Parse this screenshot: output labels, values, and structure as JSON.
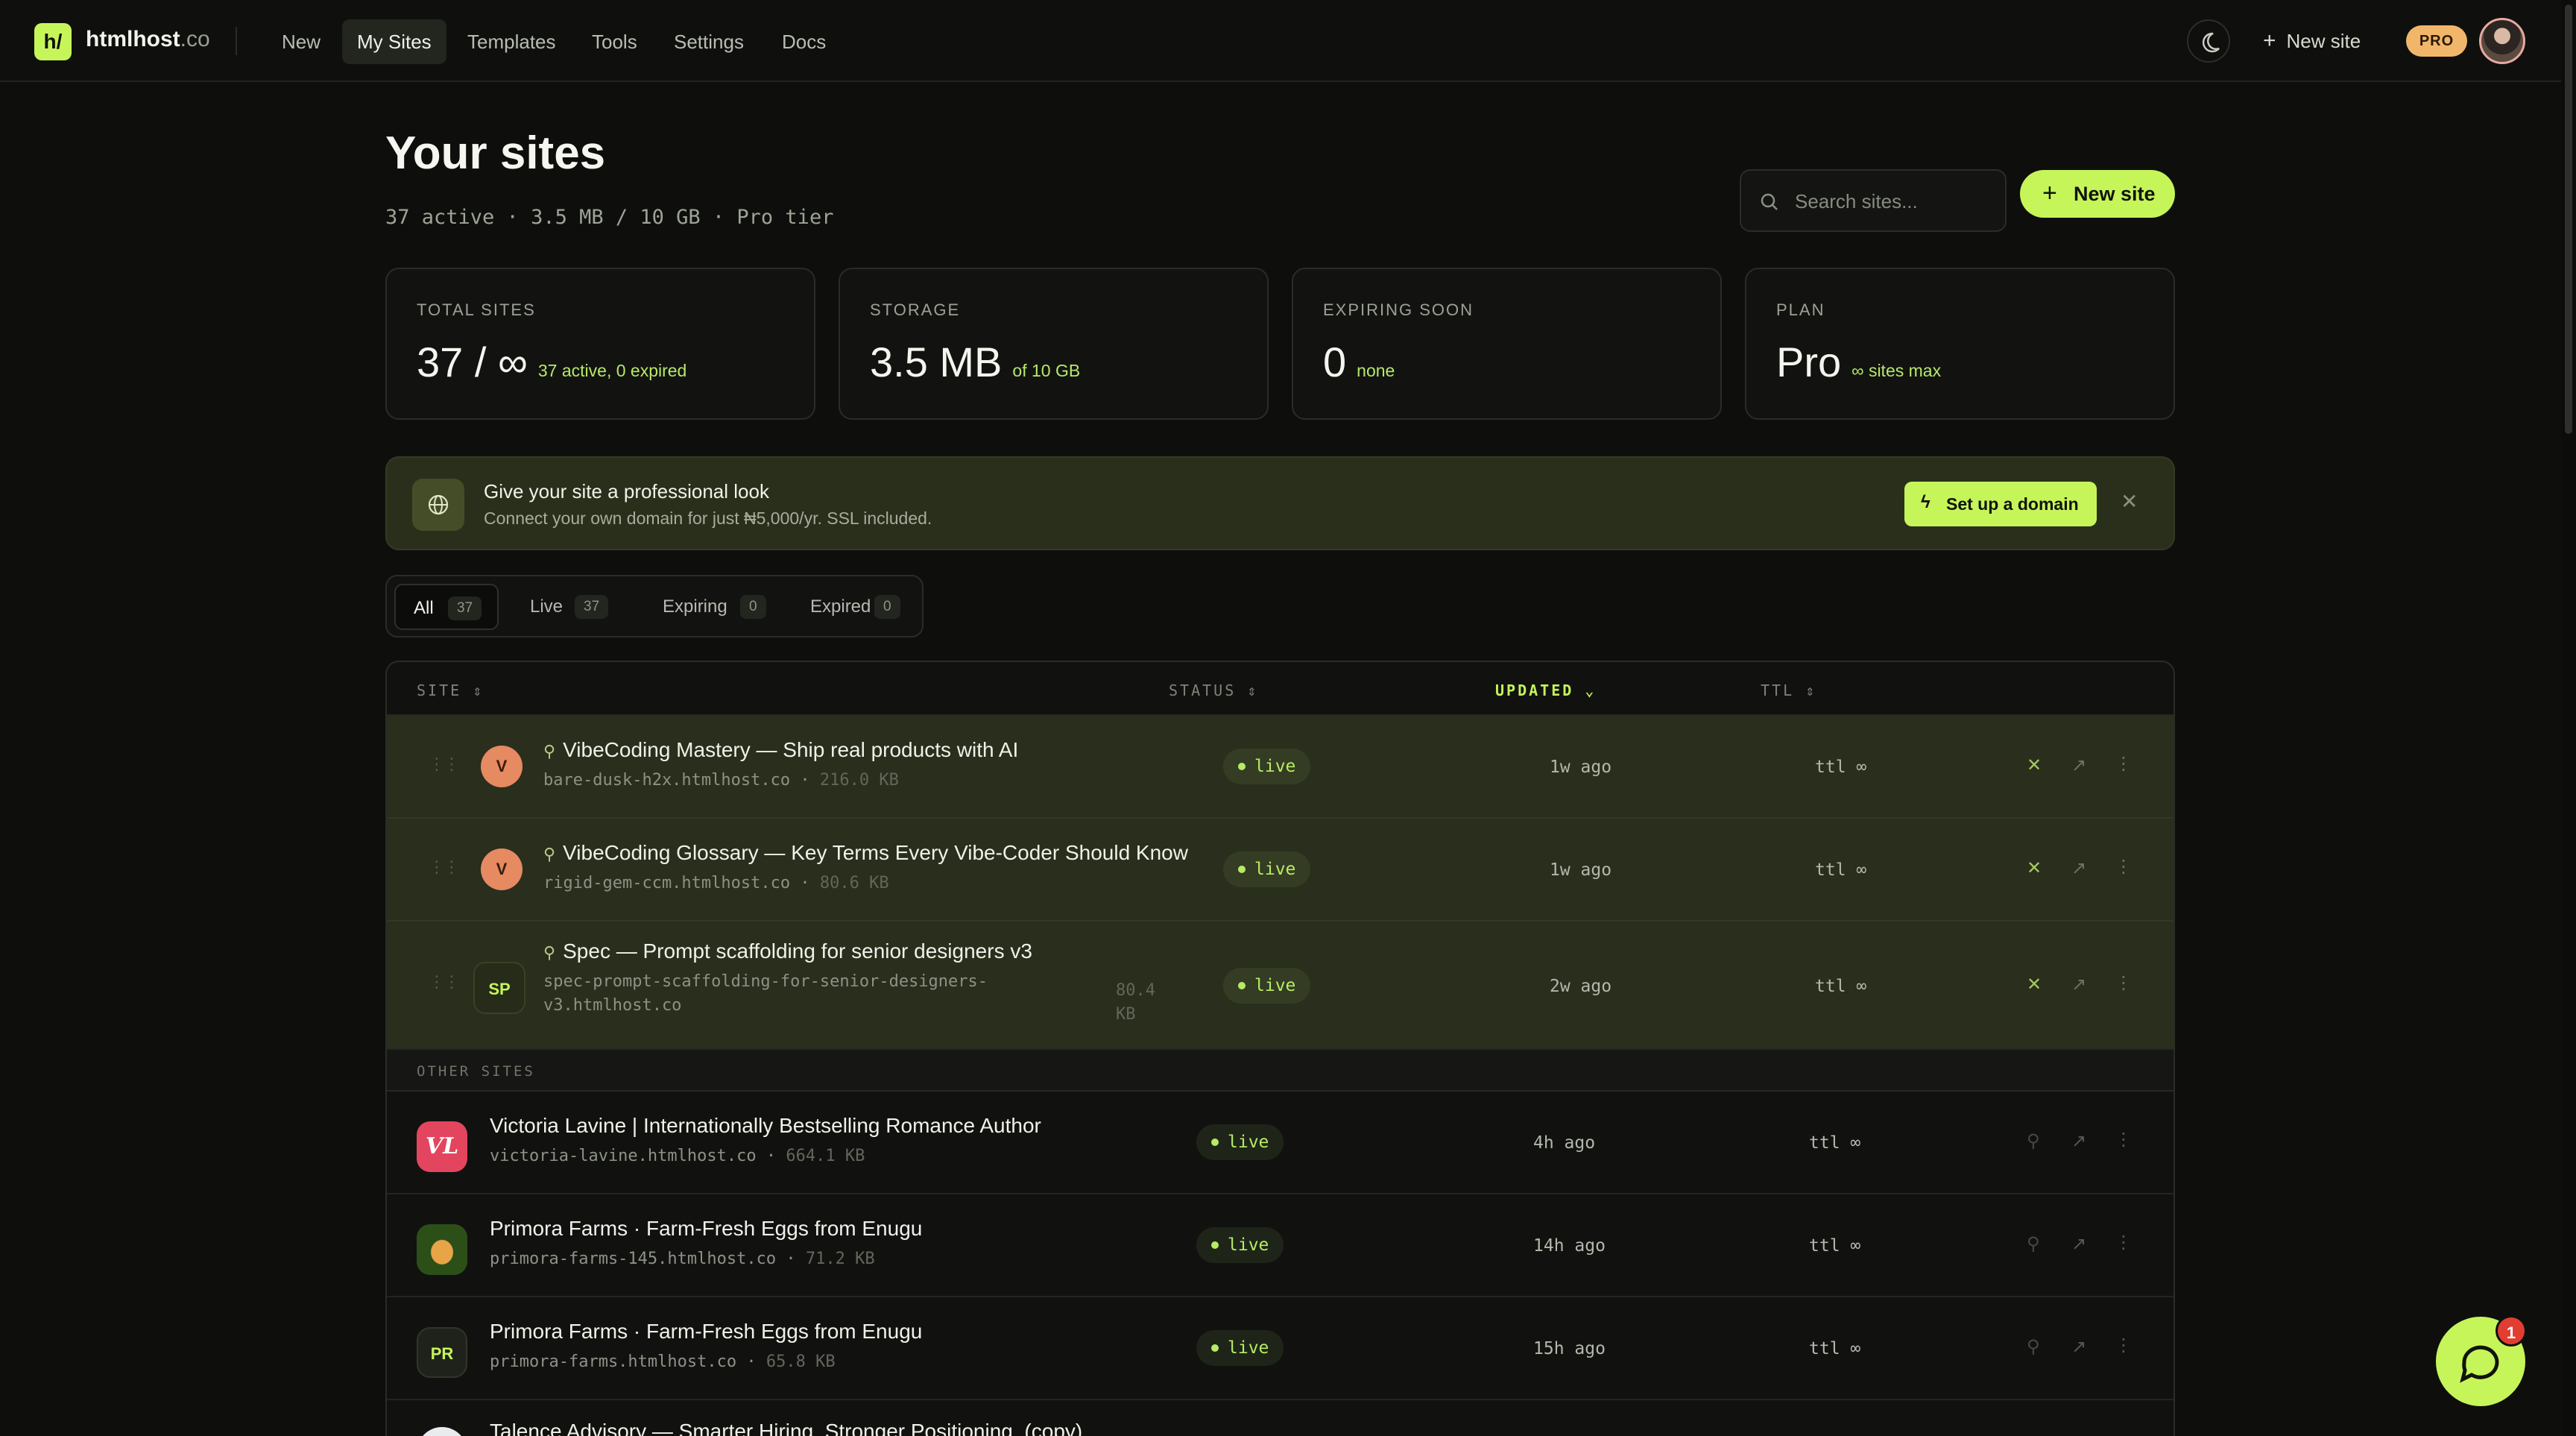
{
  "topbar": {
    "brand": "htmlhost",
    "brand_tld": ".co",
    "nav": [
      "New",
      "My Sites",
      "Templates",
      "Tools",
      "Settings",
      "Docs"
    ],
    "new_site": "New site",
    "pro": "PRO"
  },
  "header": {
    "title": "Your sites",
    "subtitle": "37 active · 3.5 MB / 10 GB · Pro tier",
    "search_placeholder": "Search sites...",
    "new_site_button": "New site"
  },
  "stats": [
    {
      "label": "TOTAL SITES",
      "value": "37 / ∞",
      "note": "37 active, 0 expired"
    },
    {
      "label": "STORAGE",
      "value": "3.5 MB",
      "note": "of 10 GB"
    },
    {
      "label": "EXPIRING SOON",
      "value": "0",
      "note": "none"
    },
    {
      "label": "PLAN",
      "value": "Pro",
      "note": "∞ sites max"
    }
  ],
  "banner": {
    "title": "Give your site a professional look",
    "text": "Connect your own domain for just ₦5,000/yr. SSL included.",
    "button": "Set up a domain"
  },
  "tabs": [
    {
      "label": "All",
      "count": "37"
    },
    {
      "label": "Live",
      "count": "37"
    },
    {
      "label": "Expiring",
      "count": "0"
    },
    {
      "label": "Expired",
      "count": "0"
    }
  ],
  "table": {
    "headers": {
      "site": "SITE",
      "status": "STATUS",
      "updated": "UPDATED",
      "ttl": "TTL"
    },
    "other_label": "OTHER SITES",
    "pinned": [
      {
        "icon": "V",
        "title": "VibeCoding Mastery — Ship real products with AI",
        "url": "bare-dusk-h2x.htmlhost.co",
        "size": "216.0 KB",
        "status": "live",
        "updated": "1w ago",
        "ttl": "ttl ∞"
      },
      {
        "icon": "V",
        "title": "VibeCoding Glossary — Key Terms Every Vibe-Coder Should Know",
        "url": "rigid-gem-ccm.htmlhost.co",
        "size": "80.6 KB",
        "status": "live",
        "updated": "1w ago",
        "ttl": "ttl ∞"
      },
      {
        "icon": "SP",
        "title": "Spec — Prompt scaffolding for senior designers v3",
        "url": "spec-prompt-scaffolding-for-senior-designers-",
        "url2": "v3.htmlhost.co",
        "size": "80.4",
        "size2": "KB",
        "status": "live",
        "updated": "2w ago",
        "ttl": "ttl ∞"
      }
    ],
    "other": [
      {
        "icon": "VL",
        "title": "Victoria Lavine | Internationally Bestselling Romance Author",
        "url": "victoria-lavine.htmlhost.co",
        "size": "664.1 KB",
        "status": "live",
        "updated": "4h ago",
        "ttl": "ttl ∞"
      },
      {
        "icon": "",
        "title": "Primora Farms · Farm-Fresh Eggs from Enugu",
        "url": "primora-farms-145.htmlhost.co",
        "size": "71.2 KB",
        "status": "live",
        "updated": "14h ago",
        "ttl": "ttl ∞"
      },
      {
        "icon": "PR",
        "title": "Primora Farms · Farm-Fresh Eggs from Enugu",
        "url": "primora-farms.htmlhost.co",
        "size": "65.8 KB",
        "status": "live",
        "updated": "15h ago",
        "ttl": "ttl ∞"
      },
      {
        "icon": "",
        "title": "Talence Advisory — Smarter Hiring. Stronger Positioning. (copy)",
        "url": "",
        "size": "",
        "status": "",
        "updated": "",
        "ttl": ""
      }
    ]
  },
  "chat": {
    "badge": "1"
  },
  "colors": {
    "accent": "#c6f55a",
    "bg": "#0e0f0d",
    "pinned_bg": "#2a2e1c",
    "live": "#b6ec63"
  }
}
